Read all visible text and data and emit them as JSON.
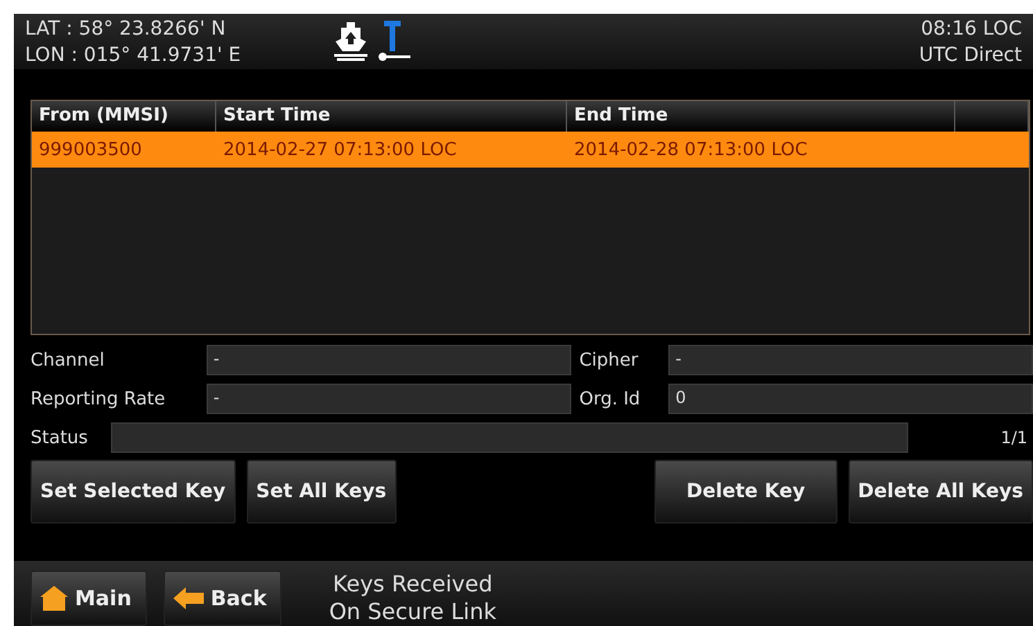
{
  "header": {
    "lat": "LAT : 58° 23.8266' N",
    "lon": "LON : 015° 41.9731' E",
    "time": "08:16 LOC",
    "time_source": "UTC Direct"
  },
  "table": {
    "columns": [
      "From (MMSI)",
      "Start Time",
      "End Time"
    ],
    "rows": [
      {
        "cells": [
          "999003500",
          "2014-02-27 07:13:00 LOC",
          "2014-02-28 07:13:00 LOC"
        ],
        "selected": true
      }
    ]
  },
  "fields": {
    "channel": {
      "label": "Channel",
      "value": "-"
    },
    "cipher": {
      "label": "Cipher",
      "value": "-"
    },
    "reporting_rate": {
      "label": "Reporting Rate",
      "value": "-"
    },
    "org_id": {
      "label": "Org. Id",
      "value": "0"
    },
    "status": {
      "label": "Status"
    },
    "page": "1/1"
  },
  "actions_left": [
    "Set Selected Key",
    "Set All Keys"
  ],
  "actions_right": [
    "Delete Key",
    "Delete All Keys"
  ],
  "nav": [
    {
      "label": "Main",
      "kind": "home"
    },
    {
      "label": "Back",
      "kind": "back"
    }
  ],
  "message": [
    "Keys Received",
    "On Secure Link"
  ]
}
